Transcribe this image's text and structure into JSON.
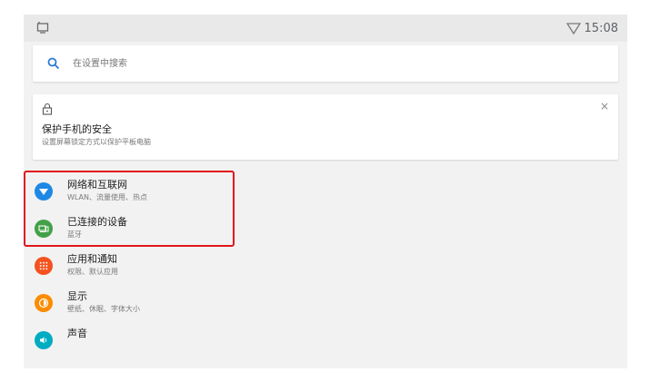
{
  "status_bar": {
    "time": "15:08"
  },
  "search": {
    "placeholder": "在设置中搜索"
  },
  "suggestion": {
    "title": "保护手机的安全",
    "subtitle": "设置屏幕锁定方式以保护平板电脑",
    "close_label": "×"
  },
  "settings": {
    "items": [
      {
        "title": "网络和互联网",
        "subtitle": "WLAN、流量使用、热点",
        "icon": "wifi-icon",
        "color": "#1e88e5"
      },
      {
        "title": "已连接的设备",
        "subtitle": "蓝牙",
        "icon": "devices-icon",
        "color": "#43a047"
      },
      {
        "title": "应用和通知",
        "subtitle": "权限、默认应用",
        "icon": "apps-icon",
        "color": "#f4511e"
      },
      {
        "title": "显示",
        "subtitle": "壁纸、休眠、字体大小",
        "icon": "brightness-icon",
        "color": "#fb8c00"
      },
      {
        "title": "声音",
        "subtitle": "",
        "icon": "volume-icon",
        "color": "#00acc1"
      }
    ]
  },
  "colors": {
    "highlight": "#e0151b"
  }
}
